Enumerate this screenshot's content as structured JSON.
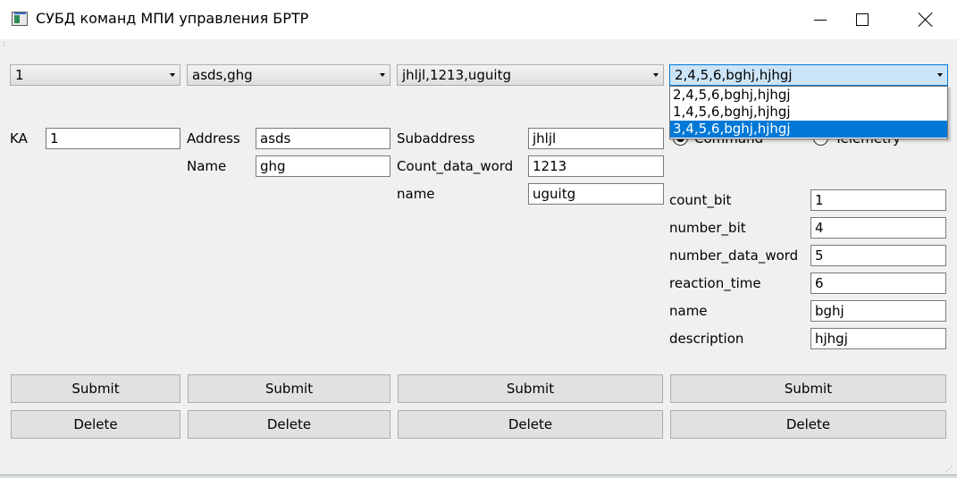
{
  "window": {
    "title": "СУБД команд МПИ управления БРТР"
  },
  "combos": [
    {
      "value": "1"
    },
    {
      "value": "asds,ghg"
    },
    {
      "value": "jhljl,1213,uguitg"
    },
    {
      "value": "2,4,5,6,bghj,hjhgj"
    }
  ],
  "dropdown": {
    "options": [
      "2,4,5,6,bghj,hjhgj",
      "1,4,5,6,bghj,hjhgj",
      "3,4,5,6,bghj,hjhgj"
    ],
    "highlighted_index": 2
  },
  "col1": {
    "ka_label": "KA",
    "ka_value": "1"
  },
  "col2": {
    "address_label": "Address",
    "address_value": "asds",
    "name_label": "Name",
    "name_value": "ghg"
  },
  "col3": {
    "subaddress_label": "Subaddress",
    "subaddress_value": "jhljl",
    "count_label": "Count_data_word",
    "count_value": "1213",
    "name_label": "name",
    "name_value": "uguitg"
  },
  "col4": {
    "radio_command": "Command",
    "radio_telemetry": "Telemetry",
    "fields": [
      {
        "label": "count_bit",
        "value": "1"
      },
      {
        "label": "number_bit",
        "value": "4"
      },
      {
        "label": "number_data_word",
        "value": "5"
      },
      {
        "label": "reaction_time",
        "value": "6"
      },
      {
        "label": "name",
        "value": "bghj"
      },
      {
        "label": "description",
        "value": "hjhgj"
      }
    ]
  },
  "buttons": {
    "submit": "Submit",
    "delete": "Delete"
  }
}
